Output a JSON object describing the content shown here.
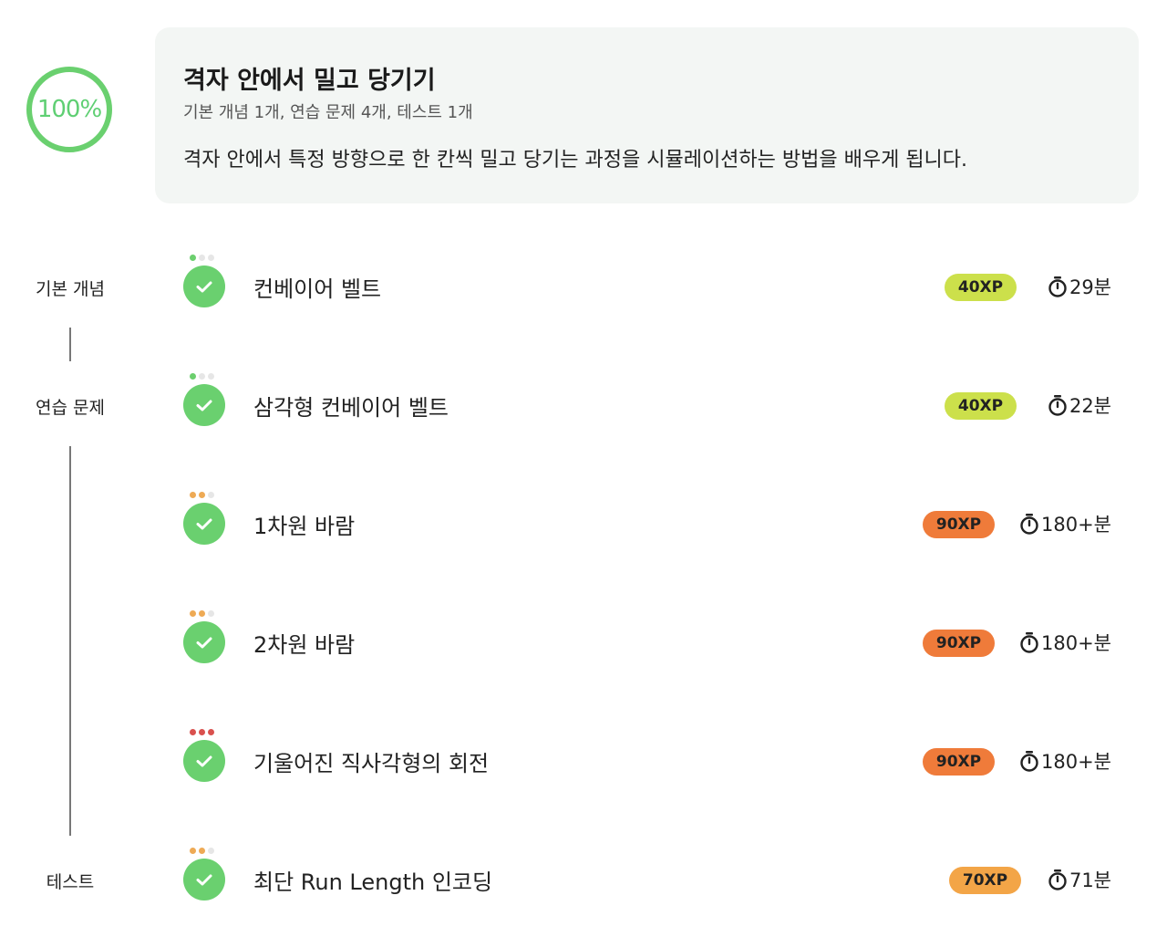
{
  "progress": {
    "label": "100%",
    "value": 1.0
  },
  "header": {
    "title": "격자 안에서 밀고 당기기",
    "subtitle": "기본 개념 1개, 연습 문제 4개, 테스트 1개",
    "description": "격자 안에서 특정 방향으로 한 칸씩 밀고 당기는 과정을 시뮬레이션하는 방법을 배우게 됩니다."
  },
  "sections": [
    {
      "label": "기본 개념"
    },
    {
      "label": "연습 문제"
    },
    {
      "label": "테스트"
    }
  ],
  "lessons": [
    {
      "title": "컨베이어 벨트",
      "xp": "40XP",
      "time": "29분",
      "difficulty": 1,
      "difficulty_color": "#6ccf6e",
      "badge_color": "#cce04b",
      "completed": true
    },
    {
      "title": "삼각형 컨베이어 벨트",
      "xp": "40XP",
      "time": "22분",
      "difficulty": 1,
      "difficulty_color": "#6ccf6e",
      "badge_color": "#cce04b",
      "completed": true
    },
    {
      "title": "1차원 바람",
      "xp": "90XP",
      "time": "180+분",
      "difficulty": 2,
      "difficulty_color": "#eeaa55",
      "badge_color": "#ef7b3a",
      "completed": true
    },
    {
      "title": "2차원 바람",
      "xp": "90XP",
      "time": "180+분",
      "difficulty": 2,
      "difficulty_color": "#eeaa55",
      "badge_color": "#ef7b3a",
      "completed": true
    },
    {
      "title": "기울어진 직사각형의 회전",
      "xp": "90XP",
      "time": "180+분",
      "difficulty": 3,
      "difficulty_color": "#d9514e",
      "badge_color": "#ef7b3a",
      "completed": true
    },
    {
      "title": "최단 Run Length 인코딩",
      "xp": "70XP",
      "time": "71분",
      "difficulty": 2,
      "difficulty_color": "#eeaa55",
      "badge_color": "#f3a547",
      "completed": true
    }
  ],
  "icons": {
    "check": "check-icon",
    "timer": "stopwatch-icon"
  }
}
